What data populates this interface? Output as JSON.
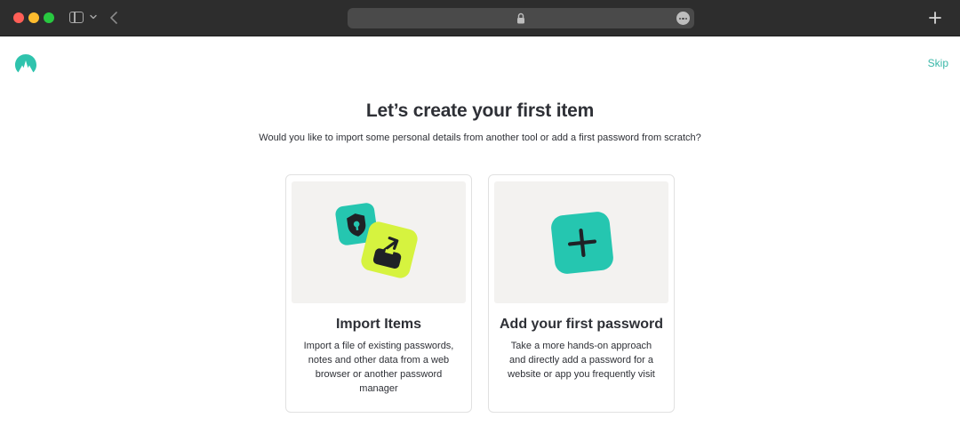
{
  "browser": {
    "colors": {
      "chrome": "#2d2d2d",
      "close": "#ff5f57",
      "minimize": "#febc2e",
      "maximize": "#28c840"
    },
    "icons": [
      "sidebar-toggle-icon",
      "chevron-down-icon",
      "back-arrow-icon",
      "lock-icon",
      "more-icon",
      "new-tab-icon"
    ]
  },
  "header": {
    "logo_icon": "nordpass-logo-icon",
    "skip_label": "Skip",
    "accent_color": "#3ab7a8"
  },
  "main": {
    "title": "Let’s create your first item",
    "subtitle": "Would you like to import some personal details from another tool or add a first password from scratch?"
  },
  "cards": [
    {
      "title": "Import Items",
      "description": "Import a file of existing passwords, notes and other data from a web browser or another password manager",
      "icon": "import-illustration-icon"
    },
    {
      "title": "Add your first password",
      "description": "Take a more hands-on approach and directly add a password for a website or app you frequently visit",
      "icon": "add-password-plus-icon"
    }
  ]
}
